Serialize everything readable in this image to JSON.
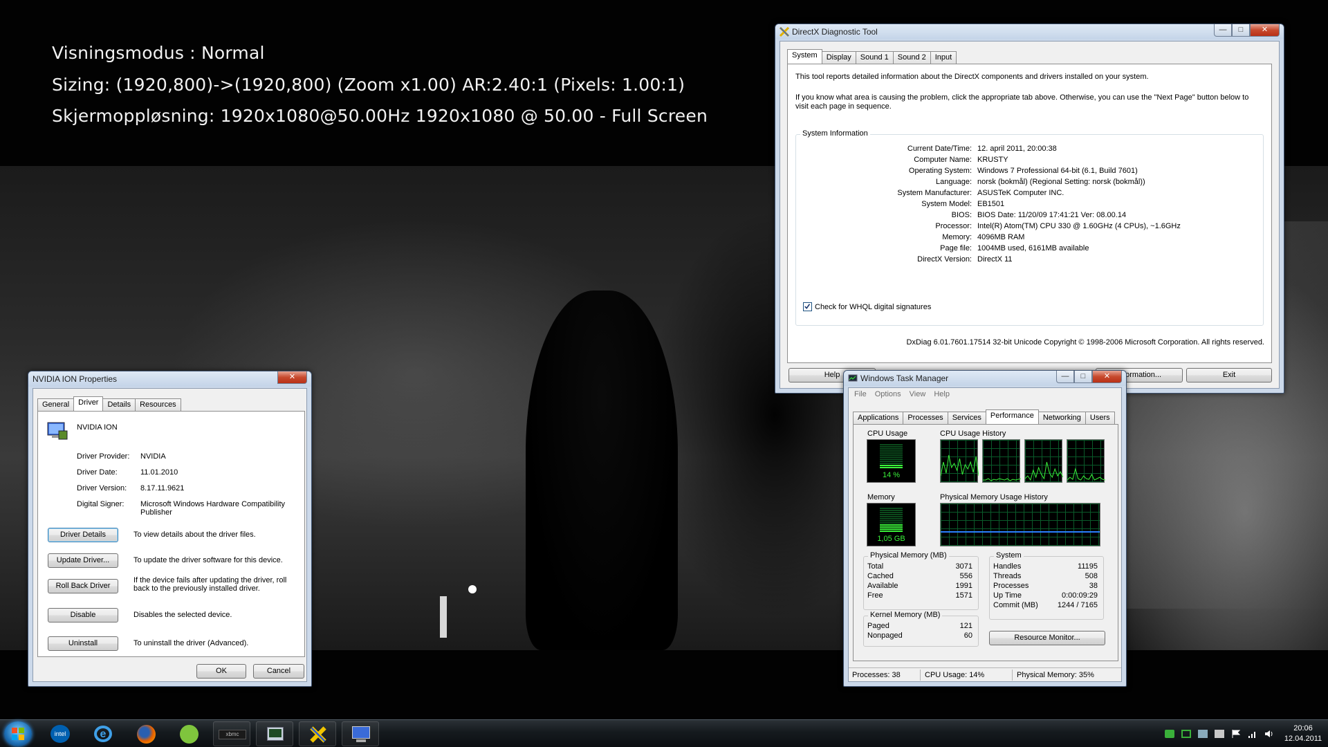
{
  "osd": {
    "line1": "Visningsmodus : Normal",
    "line2": "Sizing: (1920,800)->(1920,800) (Zoom x1.00) AR:2.40:1 (Pixels: 1.00:1)",
    "line3": "Skjermoppløsning: 1920x1080@50.00Hz 1920x1080 @ 50.00 - Full Screen"
  },
  "dxdiag": {
    "title": "DirectX Diagnostic Tool",
    "tabs": [
      "System",
      "Display",
      "Sound 1",
      "Sound 2",
      "Input"
    ],
    "intro1": "This tool reports detailed information about the DirectX components and drivers installed on your system.",
    "intro2a": "If you know what area is causing the problem, click the appropriate tab above.  Otherwise, you can use the \"Next Page\" button below to",
    "intro2b": "visit each page in sequence.",
    "group_title": "System Information",
    "rows": [
      {
        "label": "Current Date/Time:",
        "value": "12. april 2011, 20:00:38"
      },
      {
        "label": "Computer Name:",
        "value": "KRUSTY"
      },
      {
        "label": "Operating System:",
        "value": "Windows 7 Professional 64-bit (6.1, Build 7601)"
      },
      {
        "label": "Language:",
        "value": "norsk (bokmål) (Regional Setting: norsk (bokmål))"
      },
      {
        "label": "System Manufacturer:",
        "value": "ASUSTeK Computer INC."
      },
      {
        "label": "System Model:",
        "value": "EB1501"
      },
      {
        "label": "BIOS:",
        "value": "BIOS Date: 11/20/09 17:41:21 Ver: 08.00.14"
      },
      {
        "label": "Processor:",
        "value": "Intel(R) Atom(TM) CPU  330  @ 1.60GHz (4 CPUs), ~1.6GHz"
      },
      {
        "label": "Memory:",
        "value": "4096MB RAM"
      },
      {
        "label": "Page file:",
        "value": "1004MB used, 6161MB available"
      },
      {
        "label": "DirectX Version:",
        "value": "DirectX 11"
      }
    ],
    "whql_label": "Check for WHQL digital signatures",
    "whql_checked": true,
    "copyright": "DxDiag 6.01.7601.17514 32-bit Unicode  Copyright © 1998-2006 Microsoft Corporation.  All rights reserved.",
    "btn_help": "Help",
    "btn_info": "Information...",
    "btn_exit": "Exit"
  },
  "props": {
    "title": "NVIDIA ION    Properties",
    "tabs": [
      "General",
      "Driver",
      "Details",
      "Resources"
    ],
    "device_name": "NVIDIA ION",
    "rows": [
      {
        "label": "Driver Provider:",
        "value": "NVIDIA"
      },
      {
        "label": "Driver Date:",
        "value": "11.01.2010"
      },
      {
        "label": "Driver Version:",
        "value": "8.17.11.9621"
      },
      {
        "label": "Digital Signer:",
        "value": "Microsoft Windows Hardware Compatibility",
        "value2": "Publisher"
      }
    ],
    "actions": [
      {
        "label": "Driver Details",
        "desc": "To view details about the driver files.",
        "desc2": ""
      },
      {
        "label": "Update Driver...",
        "desc": "To update the driver software for this device.",
        "desc2": ""
      },
      {
        "label": "Roll Back Driver",
        "desc": "If the device fails after updating the driver, roll",
        "desc2": "back to the previously installed driver."
      },
      {
        "label": "Disable",
        "desc": "Disables the selected device.",
        "desc2": ""
      },
      {
        "label": "Uninstall",
        "desc": "To uninstall the driver (Advanced).",
        "desc2": ""
      }
    ],
    "btn_ok": "OK",
    "btn_cancel": "Cancel"
  },
  "taskmgr": {
    "title": "Windows Task Manager",
    "menu": [
      "File",
      "Options",
      "View",
      "Help"
    ],
    "tabs": [
      "Applications",
      "Processes",
      "Services",
      "Performance",
      "Networking",
      "Users"
    ],
    "cpu_usage_title": "CPU Usage",
    "cpu_usage_value": "14 %",
    "cpu_percent": 14,
    "cpu_history_title": "CPU Usage History",
    "memory_title": "Memory",
    "memory_value": "1,05 GB",
    "memory_fraction": 0.35,
    "phys_history_title": "Physical Memory Usage History",
    "phys_mem": {
      "title": "Physical Memory (MB)",
      "rows": [
        {
          "label": "Total",
          "value": "3071"
        },
        {
          "label": "Cached",
          "value": "556"
        },
        {
          "label": "Available",
          "value": "1991"
        },
        {
          "label": "Free",
          "value": "1571"
        }
      ]
    },
    "kernel_mem": {
      "title": "Kernel Memory (MB)",
      "rows": [
        {
          "label": "Paged",
          "value": "121"
        },
        {
          "label": "Nonpaged",
          "value": "60"
        }
      ]
    },
    "system": {
      "title": "System",
      "rows": [
        {
          "label": "Handles",
          "value": "11195"
        },
        {
          "label": "Threads",
          "value": "508"
        },
        {
          "label": "Processes",
          "value": "38"
        },
        {
          "label": "Up Time",
          "value": "0:00:09:29"
        },
        {
          "label": "Commit (MB)",
          "value": "1244 / 7165"
        }
      ]
    },
    "btn_resource_monitor": "Resource Monitor...",
    "status": {
      "processes": "Processes: 38",
      "cpu": "CPU Usage: 14%",
      "memory": "Physical Memory: 35%"
    }
  },
  "taskbar": {
    "clock_time": "20:06",
    "clock_date": "12.04.2011",
    "pinned": [
      "start-orb",
      "intel-icon",
      "internet-explorer-icon",
      "firefox-icon",
      "spotify-icon",
      "xbmc-icon",
      "task-manager-icon",
      "dxdiag-icon",
      "device-manager-icon"
    ]
  },
  "colors": {
    "graph_green": "#3af23a",
    "graph_grid": "#0a5a2a",
    "mem_history": "#2a7fff"
  }
}
